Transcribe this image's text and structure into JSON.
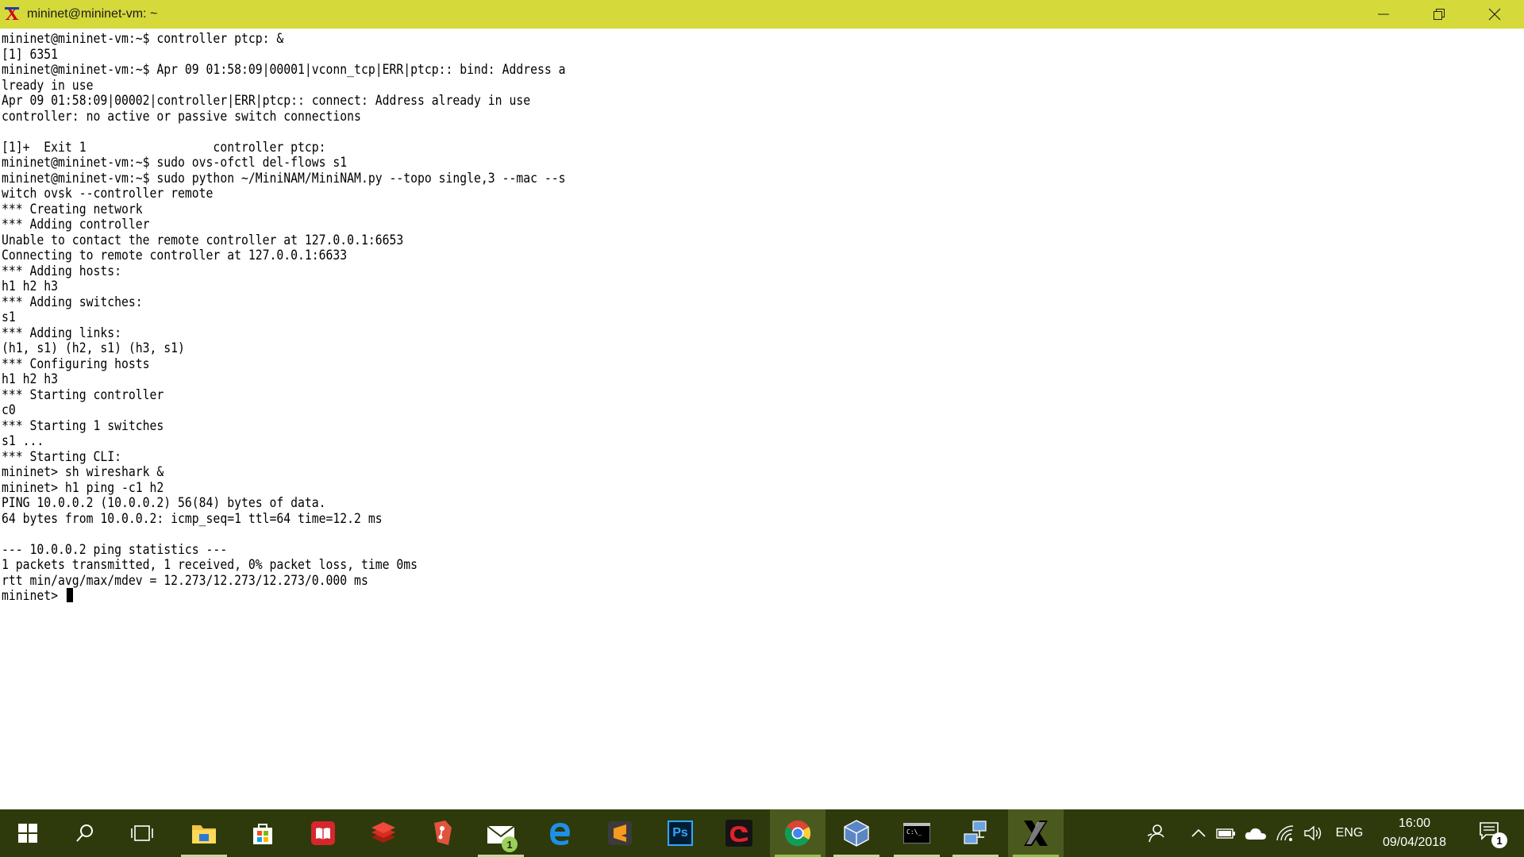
{
  "window": {
    "title": "mininet@mininet-vm: ~",
    "icon": "xming-x-icon"
  },
  "terminal": {
    "lines": [
      "mininet@mininet-vm:~$ controller ptcp: &",
      "[1] 6351",
      "mininet@mininet-vm:~$ Apr 09 01:58:09|00001|vconn_tcp|ERR|ptcp:: bind: Address a",
      "lready in use",
      "Apr 09 01:58:09|00002|controller|ERR|ptcp:: connect: Address already in use",
      "controller: no active or passive switch connections",
      "",
      "[1]+  Exit 1                  controller ptcp:",
      "mininet@mininet-vm:~$ sudo ovs-ofctl del-flows s1",
      "mininet@mininet-vm:~$ sudo python ~/MiniNAM/MiniNAM.py --topo single,3 --mac --s",
      "witch ovsk --controller remote",
      "*** Creating network",
      "*** Adding controller",
      "Unable to contact the remote controller at 127.0.0.1:6653",
      "Connecting to remote controller at 127.0.0.1:6633",
      "*** Adding hosts:",
      "h1 h2 h3",
      "*** Adding switches:",
      "s1",
      "*** Adding links:",
      "(h1, s1) (h2, s1) (h3, s1)",
      "*** Configuring hosts",
      "h1 h2 h3",
      "*** Starting controller",
      "c0",
      "*** Starting 1 switches",
      "s1 ...",
      "*** Starting CLI:",
      "mininet> sh wireshark &",
      "mininet> h1 ping -c1 h2",
      "PING 10.0.0.2 (10.0.0.2) 56(84) bytes of data.",
      "64 bytes from 10.0.0.2: icmp_seq=1 ttl=64 time=12.2 ms",
      "",
      "--- 10.0.0.2 ping statistics ---",
      "1 packets transmitted, 1 received, 0% packet loss, time 0ms",
      "rtt min/avg/max/mdev = 12.273/12.273/12.273/0.000 ms"
    ],
    "prompt": "mininet> "
  },
  "taskbar": {
    "apps": [
      {
        "name": "start-icon"
      },
      {
        "name": "search-icon"
      },
      {
        "name": "task-view-icon"
      },
      {
        "name": "file-explorer-icon"
      },
      {
        "name": "store-icon"
      },
      {
        "name": "reader-icon"
      },
      {
        "name": "stack-app-icon"
      },
      {
        "name": "git-tool-icon"
      },
      {
        "name": "mail-icon",
        "badge": "1"
      },
      {
        "name": "edge-icon"
      },
      {
        "name": "sublime-text-icon"
      },
      {
        "name": "photoshop-icon",
        "label": "Ps"
      },
      {
        "name": "garena-icon"
      },
      {
        "name": "chrome-icon"
      },
      {
        "name": "virtualbox-icon"
      },
      {
        "name": "cmd-icon"
      },
      {
        "name": "network-remote-icon"
      },
      {
        "name": "xming-icon"
      }
    ],
    "tray": {
      "language": "ENG",
      "time": "16:00",
      "date": "09/04/2018",
      "notification_badge": "1"
    }
  },
  "colors": {
    "titlebar": "#d5d93a",
    "taskbar": "#2e3a0c"
  }
}
